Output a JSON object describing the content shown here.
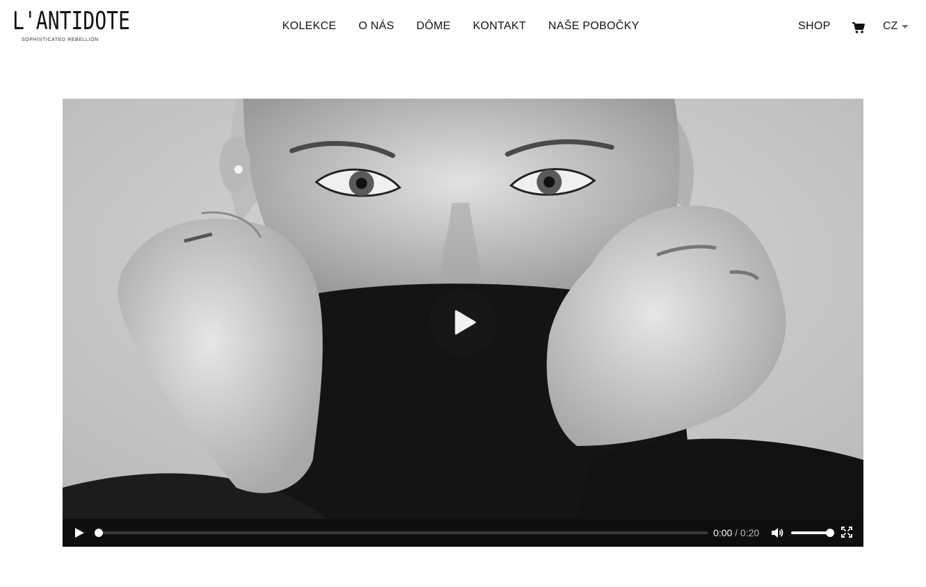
{
  "brand": {
    "logo_text": "L'ANTIDOTE",
    "tagline": "SOPHISTICATED REBELLION"
  },
  "nav": {
    "items": [
      {
        "label": "KOLEKCE"
      },
      {
        "label": "O NÁS"
      },
      {
        "label": "DÔME"
      },
      {
        "label": "KONTAKT"
      },
      {
        "label": "NAŠE POBOČKY"
      }
    ],
    "shop_label": "SHOP",
    "cart_icon": "cart-icon",
    "language": "CZ"
  },
  "video": {
    "current_time": "0:00",
    "separator": "/",
    "duration": "0:20",
    "progress_fraction": 0.0,
    "volume_fraction": 1.0,
    "icons": {
      "big_play": "play-icon",
      "play": "play-icon",
      "volume": "volume-icon",
      "fullscreen": "fullscreen-icon"
    }
  },
  "colors": {
    "text": "#111111",
    "control_bar": "#0e0e0e",
    "play_overlay": "#191919"
  }
}
